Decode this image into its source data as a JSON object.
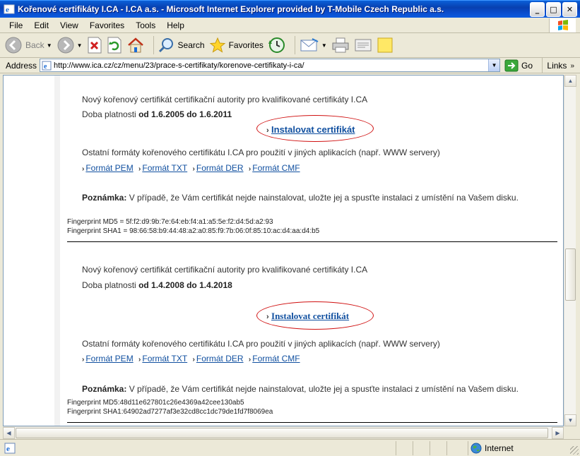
{
  "window": {
    "title": "Kořenové certifikáty I.CA - I.CA a.s. - Microsoft Internet Explorer provided by T-Mobile Czech Republic a.s."
  },
  "menu": [
    "File",
    "Edit",
    "View",
    "Favorites",
    "Tools",
    "Help"
  ],
  "toolbar": {
    "back_label": "Back",
    "search_label": "Search",
    "favorites_label": "Favorites"
  },
  "address": {
    "label": "Address",
    "url": "http://www.ica.cz/cz/menu/23/prace-s-certifikaty/korenove-certifikaty-i-ca/",
    "go_label": "Go",
    "links_label": "Links"
  },
  "content": {
    "sections": [
      {
        "desc": "Nový kořenový certifikát certifikační autority pro kvalifikované certifikáty I.CA",
        "validity_prefix": "Doba platnosti ",
        "validity_value": "od 1.6.2005 do 1.6.2011",
        "install_arrow": "›",
        "install_label": "Instalovat certifikát",
        "other_formats": "Ostatní formáty kořenového certifikátu I.CA pro použití v jiných aplikacích (např. WWW servery)",
        "formats": [
          "Formát PEM",
          "Formát TXT",
          "Formát DER",
          "Formát CMF"
        ],
        "note_label": "Poznámka:",
        "note_text": " V případě, že Vám certifikát nejde nainstalovat, uložte jej a spusťte instalaci z umístění na Vašem disku.",
        "fingerprint_md5": "Fingerprint MD5 = 5f:f2:d9:9b:7e:64:eb:f4:a1:a5:5e:f2:d4:5d:a2:93",
        "fingerprint_sha1": "Fingerprint SHA1 = 98:66:58:b9:44:48:a2:a0:85:f9:7b:06:0f:85:10:ac:d4:aa:d4:b5"
      },
      {
        "desc": "Nový kořenový certifikát certifikační autority pro kvalifikované certifikáty I.CA",
        "validity_prefix": "Doba platnosti ",
        "validity_value": "od 1.4.2008 do 1.4.2018",
        "install_arrow": "›",
        "install_label": "Instalovat certifikát",
        "other_formats": "Ostatní formáty kořenového certifikátu I.CA pro použití v jiných aplikacích (např. WWW servery)",
        "formats": [
          "Formát PEM",
          "Formát TXT",
          "Formát DER",
          "Formát CMF"
        ],
        "note_label": "Poznámka:",
        "note_text": " V případě, že Vám certifikát nejde nainstalovat, uložte jej a spusťte instalaci z umístění na Vašem disku.",
        "fingerprint_md5": "Fingerprint MD5:48d11e627801c26e4369a42cee130ab5",
        "fingerprint_sha1": "Fingerprint SHA1:64902ad7277af3e32cd8cc1dc79de1fd7f8069ea"
      }
    ]
  },
  "status": {
    "zone_label": "Internet"
  },
  "colors": {
    "link": "#1150a0",
    "highlight_oval": "#d01010",
    "titlebar": "#0a4ccc"
  }
}
